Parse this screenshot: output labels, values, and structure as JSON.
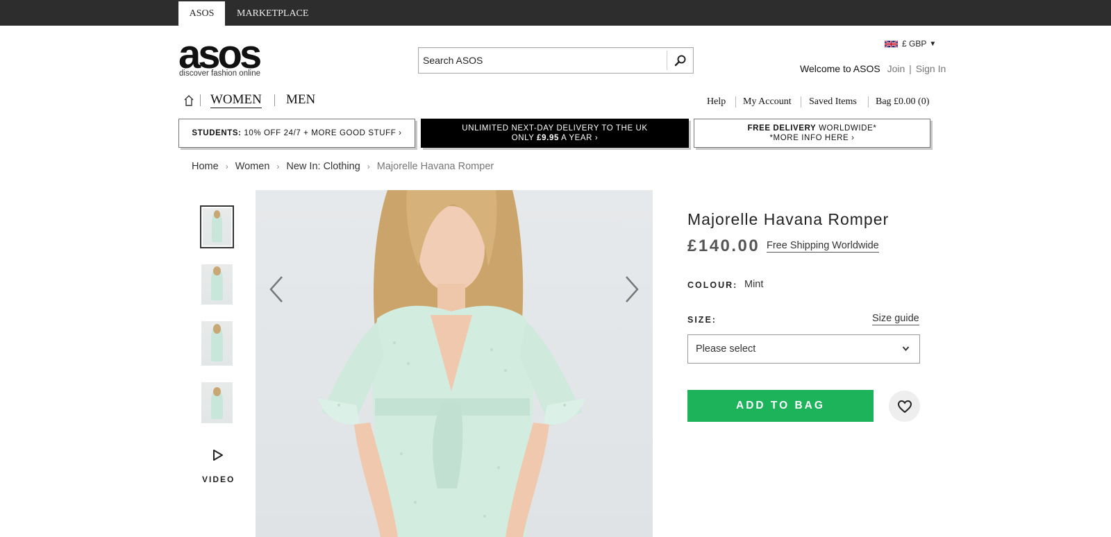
{
  "topbar": {
    "tab_asos": "ASOS",
    "tab_marketplace": "MARKETPLACE"
  },
  "header": {
    "logo_text": "asos",
    "logo_tagline": "discover fashion online",
    "search_placeholder": "Search ASOS",
    "currency": "£ GBP",
    "welcome": "Welcome to ASOS",
    "join": "Join",
    "sign_in": "Sign In"
  },
  "nav": {
    "women": "WOMEN",
    "men": "MEN",
    "help": "Help",
    "account": "My Account",
    "saved": "Saved Items",
    "bag": "Bag £0.00 (0)"
  },
  "promos": {
    "students_bold": "STUDENTS:",
    "students_rest": " 10% OFF 24/7 + MORE GOOD STUFF ›",
    "delivery_line1": "UNLIMITED NEXT-DAY DELIVERY TO THE UK",
    "delivery_line2_a": "ONLY ",
    "delivery_line2_bold": "£9.95",
    "delivery_line2_b": " A YEAR ›",
    "free_bold": "FREE DELIVERY",
    "free_rest": " WORLDWIDE*",
    "free_line2": "*MORE INFO HERE ›"
  },
  "breadcrumb": [
    "Home",
    "Women",
    "New In: Clothing",
    "Majorelle Havana Romper"
  ],
  "gallery": {
    "video_label": "VIDEO"
  },
  "product": {
    "title": "Majorelle Havana Romper",
    "price": "£140.00",
    "shipping": "Free Shipping Worldwide",
    "colour_label": "COLOUR:",
    "colour_value": "Mint",
    "size_label": "SIZE:",
    "size_guide": "Size guide",
    "size_placeholder": "Please select",
    "add_to_bag": "ADD TO BAG"
  },
  "colors": {
    "accent_green": "#1cb35a",
    "topbar": "#2d2d2d"
  }
}
